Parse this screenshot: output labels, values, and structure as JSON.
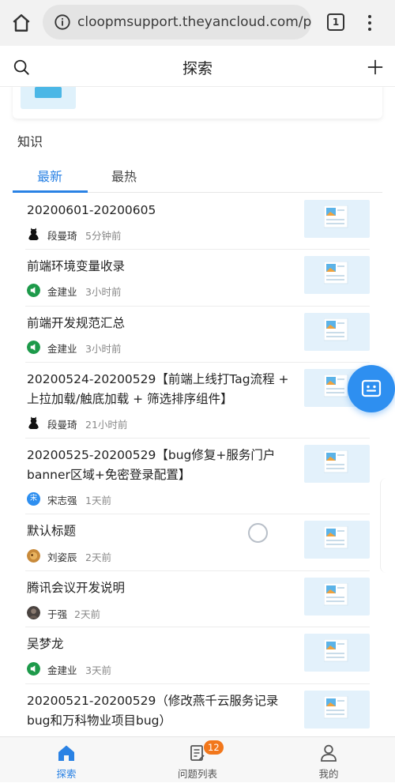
{
  "browser": {
    "url": "cloopmsupport.theyancloud.com/por",
    "tab_count": "1"
  },
  "header": {
    "title": "探索"
  },
  "section": {
    "title": "知识"
  },
  "tabs": [
    {
      "label": "最新",
      "active": true
    },
    {
      "label": "最热",
      "active": false
    }
  ],
  "articles": [
    {
      "title": "20200601-20200605",
      "author": "段曼琦",
      "time": "5分钟前",
      "avatar": "black-cat"
    },
    {
      "title": "前端环境变量收录",
      "author": "金建业",
      "time": "3小时前",
      "avatar": "green-speaker"
    },
    {
      "title": "前端开发规范汇总",
      "author": "金建业",
      "time": "3小时前",
      "avatar": "green-speaker"
    },
    {
      "title": "20200524-20200529【前端上线打Tag流程 + 上拉加载/触底加载 + 筛选排序组件】",
      "author": "段曼琦",
      "time": "21小时前",
      "avatar": "black-cat"
    },
    {
      "title": "20200525-20200529【bug修复+服务门户banner区域+免密登录配置】",
      "author": "宋志强",
      "time": "1天前",
      "avatar": "blue-letter",
      "avatar_text": "宋"
    },
    {
      "title": "默认标题",
      "author": "刘姿辰",
      "time": "2天前",
      "avatar": "orange-photo"
    },
    {
      "title": "腾讯会议开发说明",
      "author": "于强",
      "time": "2天前",
      "avatar": "dark-photo"
    },
    {
      "title": "吴梦龙",
      "author": "金建业",
      "time": "3天前",
      "avatar": "green-speaker"
    },
    {
      "title": "20200521-20200529（修改燕千云服务记录bug和万科物业项目bug）",
      "author": "",
      "time": "",
      "avatar": ""
    }
  ],
  "bottom_nav": [
    {
      "label": "探索",
      "icon": "home-icon",
      "active": true
    },
    {
      "label": "问题列表",
      "icon": "document-icon",
      "active": false,
      "badge": "12"
    },
    {
      "label": "我的",
      "icon": "user-icon",
      "active": false
    }
  ],
  "colors": {
    "accent": "#2a82e4",
    "badge": "#f2771b",
    "float_button": "#2e8ff0",
    "thumb_bg": "#e3f1fb"
  }
}
